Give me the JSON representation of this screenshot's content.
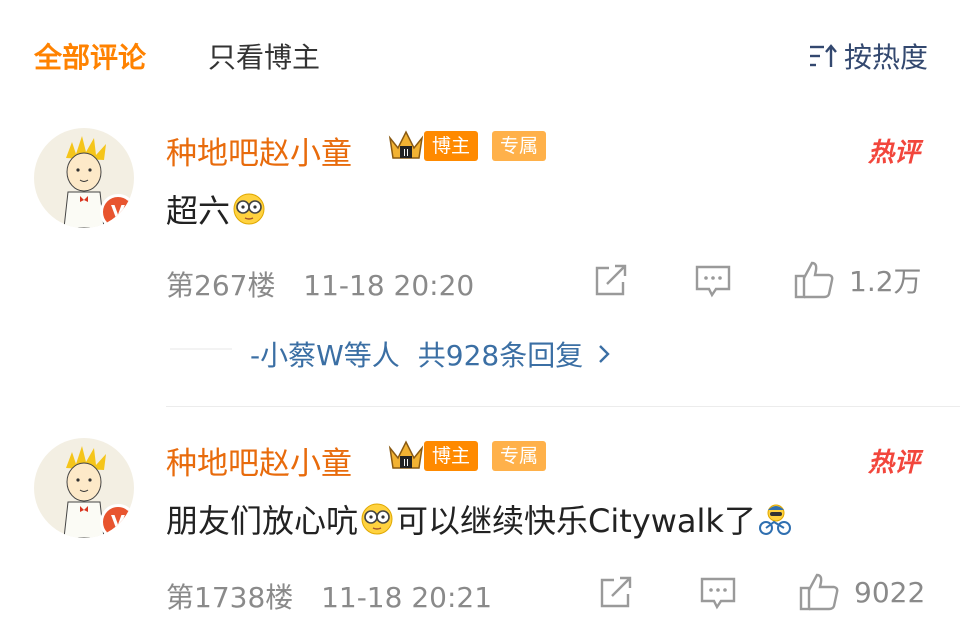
{
  "tabs": {
    "all": "全部评论",
    "blogger_only": "只看博主",
    "sort": "按热度"
  },
  "colors": {
    "accent": "#ff8200",
    "username": "#e86b0c",
    "link": "#3b6fa4",
    "hot": "#f2463c"
  },
  "comments": [
    {
      "username": "种地吧赵小童",
      "badge_blogger": "博主",
      "badge_exclusive": "专属",
      "hot_label": "热评",
      "text_before": "超六",
      "text_after": "",
      "floor": "第267楼",
      "time": "11-18 20:20",
      "likes": "1.2万",
      "reply_prefix": "-小蔡W等人",
      "reply_count": "共928条回复"
    },
    {
      "username": "种地吧赵小童",
      "badge_blogger": "博主",
      "badge_exclusive": "专属",
      "hot_label": "热评",
      "text_before": "朋友们放心吭",
      "text_after": "可以继续快乐Citywalk了",
      "floor": "第1738楼",
      "time": "11-18 20:21",
      "likes": "9022"
    }
  ]
}
